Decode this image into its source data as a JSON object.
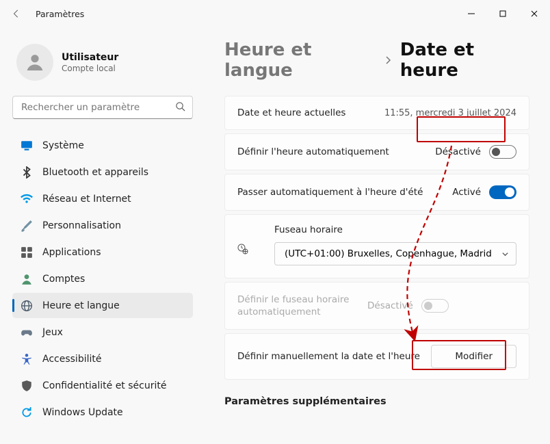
{
  "window": {
    "title": "Paramètres"
  },
  "user": {
    "name": "Utilisateur",
    "sub": "Compte local"
  },
  "search": {
    "placeholder": "Rechercher un paramètre"
  },
  "sidebar": {
    "items": [
      {
        "label": "Système",
        "icon": "monitor",
        "color": "#0078d4"
      },
      {
        "label": "Bluetooth et appareils",
        "icon": "bluetooth",
        "color": "#3a3a3a"
      },
      {
        "label": "Réseau et Internet",
        "icon": "wifi",
        "color": "#0099e5"
      },
      {
        "label": "Personnalisation",
        "icon": "brush",
        "color": "#6b8ea0"
      },
      {
        "label": "Applications",
        "icon": "apps",
        "color": "#5a5a5a"
      },
      {
        "label": "Comptes",
        "icon": "person",
        "color": "#4f946e"
      },
      {
        "label": "Heure et langue",
        "icon": "globe-clock",
        "color": "#4a5a6a",
        "selected": true
      },
      {
        "label": "Jeux",
        "icon": "gamepad",
        "color": "#6a7a8a"
      },
      {
        "label": "Accessibilité",
        "icon": "accessibility",
        "color": "#3665c9"
      },
      {
        "label": "Confidentialité et sécurité",
        "icon": "shield",
        "color": "#5a5a5a"
      },
      {
        "label": "Windows Update",
        "icon": "update",
        "color": "#0099e5"
      }
    ]
  },
  "breadcrumb": {
    "parent": "Heure et langue",
    "current": "Date et heure"
  },
  "cards": {
    "current": {
      "label": "Date et heure actuelles",
      "value": "11:55, mercredi 3 juillet 2024"
    },
    "auto_time": {
      "label": "Définir l'heure automatiquement",
      "state_label": "Désactivé",
      "state": "off"
    },
    "dst": {
      "label": "Passer automatiquement à l'heure d'été",
      "state_label": "Activé",
      "state": "on"
    },
    "timezone": {
      "label": "Fuseau horaire",
      "value": "(UTC+01:00) Bruxelles, Copenhague, Madrid"
    },
    "auto_tz": {
      "label": "Définir le fuseau horaire automatiquement",
      "state_label": "Désactivé",
      "state": "disabled"
    },
    "manual": {
      "label": "Définir manuellement la date et l'heure",
      "button": "Modifier"
    }
  },
  "section_heading": "Paramètres supplémentaires"
}
